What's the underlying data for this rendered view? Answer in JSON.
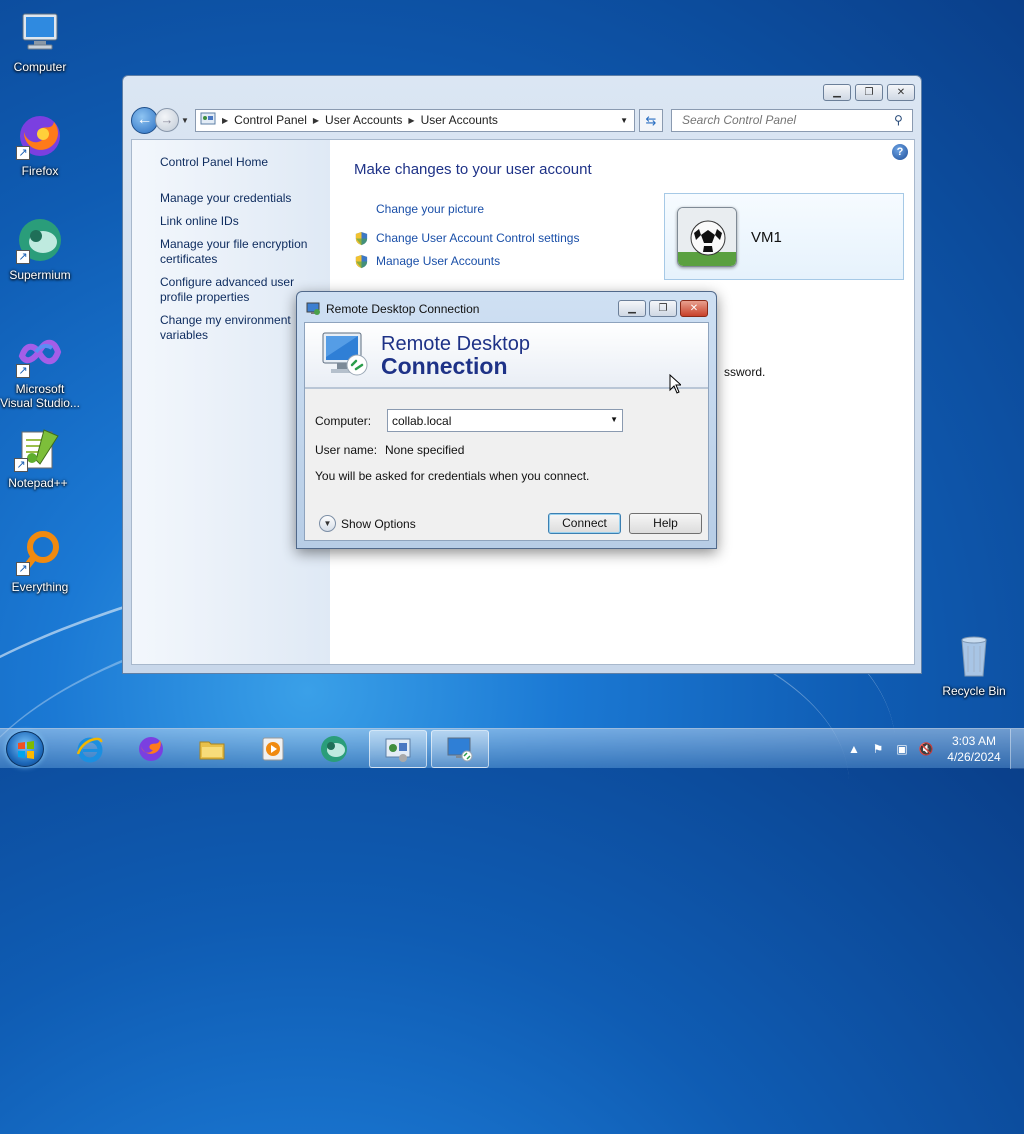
{
  "desktop": {
    "icons": [
      {
        "label": "Computer",
        "icon": "computer-icon"
      },
      {
        "label": "Firefox",
        "icon": "firefox-icon"
      },
      {
        "label": "Supermium",
        "icon": "supermium-icon"
      },
      {
        "label": "Microsoft Visual Studio...",
        "icon": "visual-studio-icon"
      },
      {
        "label": "Notepad++",
        "icon": "notepadpp-icon"
      },
      {
        "label": "Everything",
        "icon": "everything-icon"
      },
      {
        "label": "Recycle Bin",
        "icon": "recycle-bin-icon"
      }
    ]
  },
  "control_panel": {
    "breadcrumb": [
      "Control Panel",
      "User Accounts",
      "User Accounts"
    ],
    "search_placeholder": "Search Control Panel",
    "sidebar": [
      "Control Panel Home",
      "Manage your credentials",
      "Link online IDs",
      "Manage your file encryption certificates",
      "Configure advanced user profile properties",
      "Change my environment variables"
    ],
    "title": "Make changes to your user account",
    "tasks": [
      {
        "label": "Change your picture",
        "shield": false
      },
      {
        "label": "Change User Account Control settings",
        "shield": true
      },
      {
        "label": "Manage User Accounts",
        "shield": true
      }
    ],
    "user": {
      "name": "VM1"
    },
    "partial_text": "ssword."
  },
  "rdc_dialog": {
    "window_title": "Remote Desktop Connection",
    "banner_line1": "Remote Desktop",
    "banner_line2": "Connection",
    "computer_label": "Computer:",
    "computer_value": "collab.local",
    "username_label": "User name:",
    "username_value": "None specified",
    "info_text": "You will be asked for credentials when you connect.",
    "show_options": "Show Options",
    "connect_label": "Connect",
    "help_label": "Help"
  },
  "taskbar": {
    "apps": [
      "internet-explorer-icon",
      "firefox-icon",
      "file-explorer-icon",
      "media-player-icon",
      "supermium-icon",
      "control-panel-icon",
      "remote-desktop-icon"
    ],
    "clock_time": "3:03 AM",
    "clock_date": "4/26/2024"
  },
  "colors": {
    "link": "#1a4fa8",
    "title": "#1e3287",
    "desktop": "#1b79d4"
  }
}
